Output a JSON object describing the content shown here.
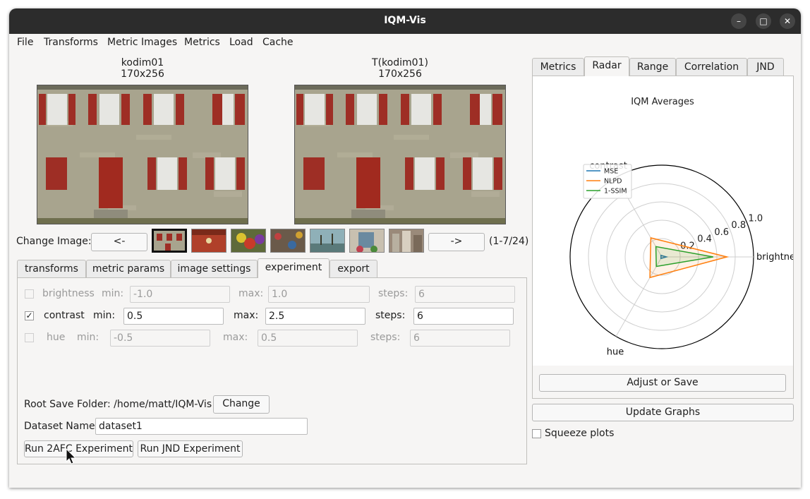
{
  "window": {
    "title": "IQM-Vis"
  },
  "menu": [
    "File",
    "Transforms",
    "Metric Images",
    "Metrics",
    "Load",
    "Cache"
  ],
  "images": {
    "reference": {
      "name": "kodim01",
      "size": "170x256"
    },
    "transformed": {
      "name": "T(kodim01)",
      "size": "170x256"
    }
  },
  "change_image": {
    "label": "Change Image:",
    "prev": "<-",
    "next": "->",
    "counter": "(1-7/24)"
  },
  "left_tabs": [
    "transforms",
    "metric params",
    "image settings",
    "experiment",
    "export"
  ],
  "experiment": {
    "rows": [
      {
        "name": "brightness",
        "checked": false,
        "min_label": "min:",
        "min": "-1.0",
        "max_label": "max:",
        "max": "1.0",
        "steps_label": "steps:",
        "steps": "6"
      },
      {
        "name": "contrast",
        "checked": true,
        "min_label": "min:",
        "min": "0.5",
        "max_label": "max:",
        "max": "2.5",
        "steps_label": "steps:",
        "steps": "6"
      },
      {
        "name": "hue",
        "checked": false,
        "min_label": "min:",
        "min": "-0.5",
        "max_label": "max:",
        "max": "0.5",
        "steps_label": "steps:",
        "steps": "6"
      }
    ],
    "check_mark": "✓",
    "root_label": "Root Save Folder: /home/matt/IQM-Vis",
    "change_btn": "Change",
    "dataset_label": "Dataset Name",
    "dataset_value": "dataset1",
    "run_2afc": "Run 2AFC Experiment",
    "run_jnd": "Run JND Experiment"
  },
  "right_tabs": [
    "Metrics",
    "Radar",
    "Range",
    "Correlation",
    "JND"
  ],
  "radar": {
    "adjust_btn": "Adjust or Save",
    "update_btn": "Update Graphs",
    "squeeze_label": "Squeeze plots"
  },
  "chart_data": {
    "type": "radar",
    "title": "IQM Averages",
    "axes": [
      "brightness",
      "contrast",
      "hue"
    ],
    "axis_labels_shown": [
      "brightne",
      "contrast",
      "hue"
    ],
    "rlim": [
      0,
      1.0
    ],
    "rticks": [
      "0.2",
      "0.4",
      "0.6",
      "0.8",
      "1.0"
    ],
    "series": [
      {
        "name": "MSE",
        "color": "#1f77b4",
        "values": [
          0.05,
          0.02,
          0.02
        ]
      },
      {
        "name": "NLPD",
        "color": "#ff7f0e",
        "values": [
          0.71,
          0.24,
          0.26
        ]
      },
      {
        "name": "1-SSIM",
        "color": "#2ca02c",
        "values": [
          0.56,
          0.13,
          0.12
        ]
      }
    ],
    "legend": "top-left"
  }
}
